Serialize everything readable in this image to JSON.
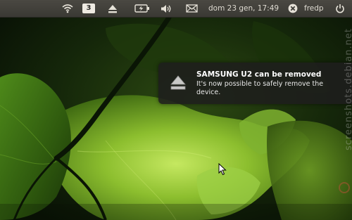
{
  "panel": {
    "workspace_number": "3",
    "clock": "dom 23 gen, 17:49",
    "username": "fredp",
    "indicators": {
      "network": "wifi-icon",
      "workspace": "workspace-indicator",
      "eject": "eject-icon",
      "battery": "battery-charging-icon",
      "volume": "volume-icon",
      "messages": "envelope-icon",
      "user": "user-status-icon",
      "session": "power-icon"
    }
  },
  "notification": {
    "icon": "eject-icon",
    "title": "SAMSUNG U2 can be removed",
    "body": "It's now possible to safely remove the device."
  },
  "watermark": {
    "text": "screenshots.debian.net"
  },
  "colors": {
    "panel": "#3f3e39",
    "panel_text": "#dfdbd2",
    "notification_bg": "#1e1e1c",
    "wallpaper_dark": "#0d1a08",
    "leaf_light": "#8bc34a"
  }
}
